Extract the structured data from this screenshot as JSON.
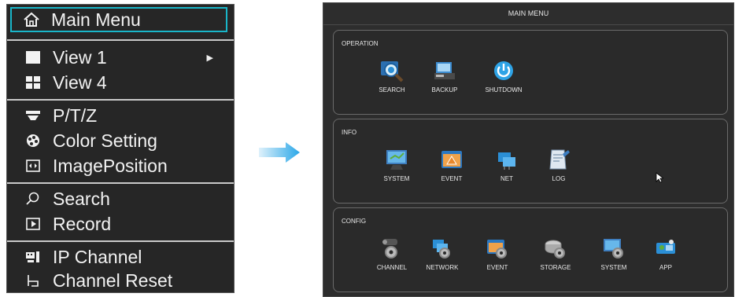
{
  "context_menu": {
    "items": [
      {
        "label": "Main Menu",
        "icon": "home-icon"
      },
      {
        "label": "View 1",
        "icon": "single-view-icon",
        "has_submenu": true
      },
      {
        "label": "View 4",
        "icon": "quad-view-icon"
      },
      {
        "label": "P/T/Z",
        "icon": "ptz-icon"
      },
      {
        "label": "Color Setting",
        "icon": "color-palette-icon"
      },
      {
        "label": "ImagePosition",
        "icon": "image-position-icon"
      },
      {
        "label": "Search",
        "icon": "search-icon"
      },
      {
        "label": "Record",
        "icon": "record-icon"
      },
      {
        "label": "IP Channel",
        "icon": "ip-channel-icon"
      },
      {
        "label": "Channel Reset",
        "icon": "channel-reset-icon"
      }
    ],
    "selected": "Main Menu",
    "highlight_color": "#19b6c9"
  },
  "main_menu": {
    "title": "MAIN MENU",
    "sections": [
      {
        "title": "OPERATION",
        "items": [
          {
            "label": "SEARCH",
            "icon": "search-icon"
          },
          {
            "label": "BACKUP",
            "icon": "backup-icon"
          },
          {
            "label": "SHUTDOWN",
            "icon": "power-icon"
          }
        ]
      },
      {
        "title": "INFO",
        "items": [
          {
            "label": "SYSTEM",
            "icon": "monitor-icon"
          },
          {
            "label": "EVENT",
            "icon": "warning-icon"
          },
          {
            "label": "NET",
            "icon": "network-icon"
          },
          {
            "label": "LOG",
            "icon": "log-icon"
          }
        ]
      },
      {
        "title": "CONFIG",
        "items": [
          {
            "label": "CHANNEL",
            "icon": "camera-gear-icon"
          },
          {
            "label": "NETWORK",
            "icon": "network-gear-icon"
          },
          {
            "label": "EVENT",
            "icon": "event-gear-icon"
          },
          {
            "label": "STORAGE",
            "icon": "storage-gear-icon"
          },
          {
            "label": "SYSTEM",
            "icon": "system-gear-icon"
          },
          {
            "label": "APP",
            "icon": "app-icon"
          }
        ]
      }
    ]
  },
  "colors": {
    "arrow": "#2aa7e8",
    "icon_blue": "#2b8fd6",
    "icon_orange": "#e8872b",
    "icon_green": "#5fae3a"
  }
}
